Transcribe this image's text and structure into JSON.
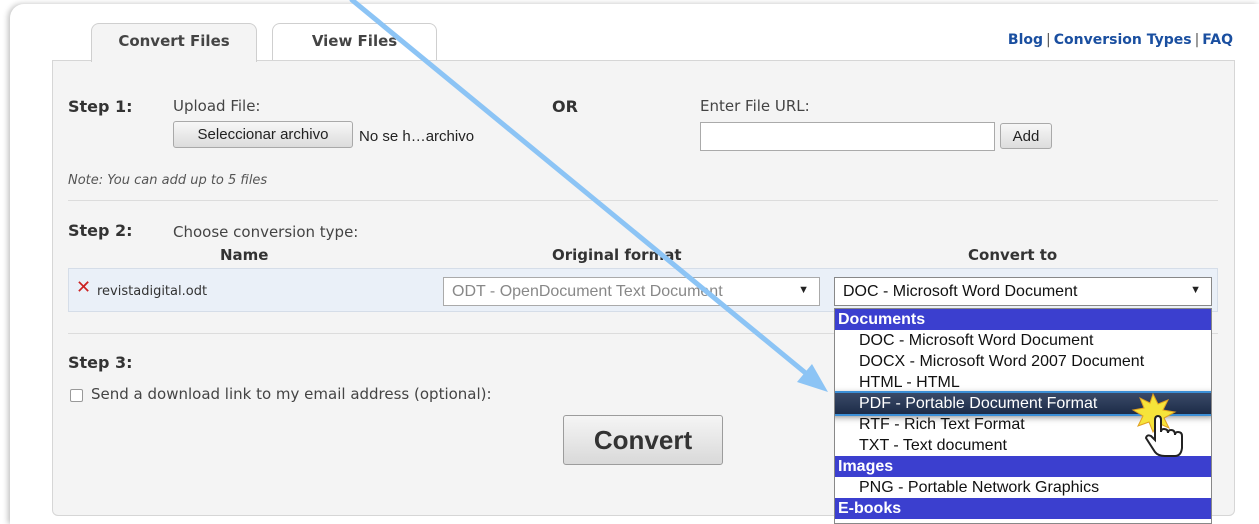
{
  "tabs": {
    "convert_files": "Convert Files",
    "view_files": "View Files"
  },
  "top_links": {
    "blog": "Blog",
    "separator": "|",
    "conversion_types": "Conversion Types",
    "faq": "FAQ"
  },
  "step1": {
    "label": "Step 1:",
    "upload_label": "Upload File:",
    "file_button": "Seleccionar archivo",
    "file_name": "No se h…archivo",
    "or": "OR",
    "url_label": "Enter File URL:",
    "url_value": "",
    "add_button": "Add",
    "note": "Note: You can add up to 5 files"
  },
  "step2": {
    "label": "Step 2:",
    "instruction": "Choose conversion type:",
    "columns": [
      "Name",
      "Original format",
      "Convert to"
    ],
    "row": {
      "file": "revistadigital.odt",
      "original_format": "ODT - OpenDocument Text Document",
      "convert_to": "DOC - Microsoft Word Document"
    }
  },
  "step3": {
    "label": "Step 3:",
    "email_option": "Send a download link to my email address (optional):",
    "email_checked": false
  },
  "convert_button": "Convert",
  "dropdown": {
    "groups": [
      "Documents",
      "Images",
      "E-books"
    ],
    "items": [
      "DOC - Microsoft Word Document",
      "DOCX - Microsoft Word 2007 Document",
      "HTML - HTML",
      "PDF - Portable Document Format",
      "RTF - Rich Text Format",
      "TXT - Text document",
      "PNG - Portable Network Graphics"
    ],
    "highlighted": "PDF - Portable Document Format"
  },
  "icons": {
    "remove": "close-x-icon",
    "dropdown_arrow": "triangle-down-icon",
    "cursor": "hand-pointer-icon",
    "annotation": "arrow-annotation"
  },
  "colors": {
    "link": "#1a4fa0",
    "group_header": "#3b3fcf",
    "highlight": "#1d2c48",
    "remove_icon": "#cc2222",
    "annotation_arrow": "#8cc4f5"
  }
}
